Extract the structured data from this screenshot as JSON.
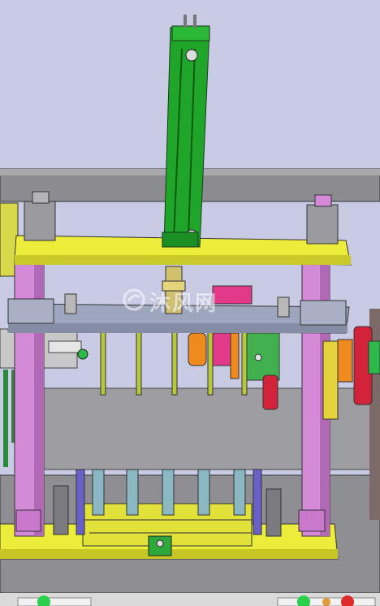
{
  "watermark": {
    "text": "沐风网"
  },
  "palette": {
    "background": "#c9cbe4",
    "frame_gray": "#8f8f93",
    "plate_yellow": "#ecec3a",
    "plate_blue_gray": "#9ea6bd",
    "pillar_pink": "#d58ad8",
    "cylinder_green": "#1fa52a",
    "accent_magenta": "#e2398a",
    "accent_orange": "#ef8a1e",
    "accent_red": "#d3233a",
    "pin_yellow_green": "#b7c83b",
    "pin_teal": "#8ab7c2",
    "pin_purple": "#6a60c9"
  }
}
